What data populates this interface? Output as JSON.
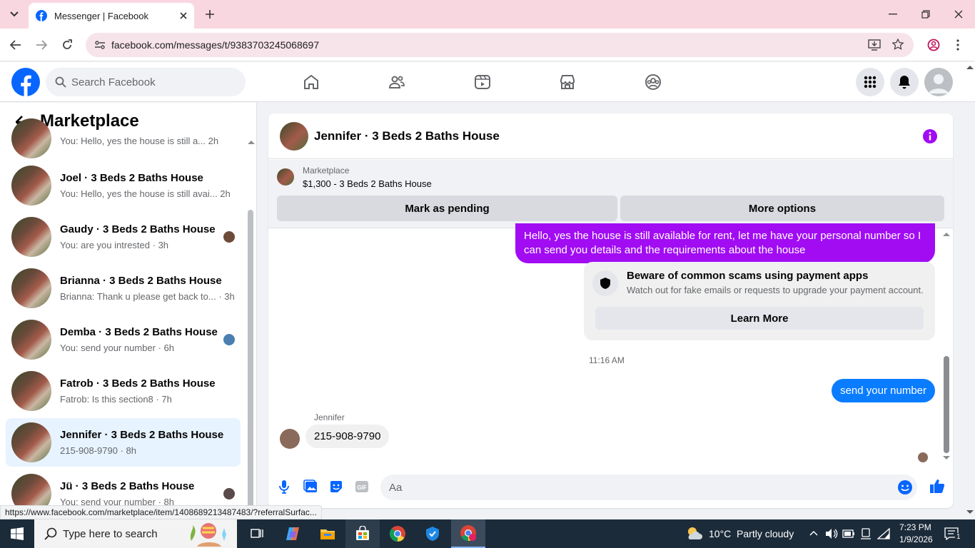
{
  "browser": {
    "tab_title": "Messenger | Facebook",
    "url": "facebook.com/messages/t/9383703245068697"
  },
  "fb": {
    "search_placeholder": "Search Facebook"
  },
  "left": {
    "title": "Marketplace",
    "conversations": [
      {
        "name": "",
        "preview": "You: Hello, yes the house is still a...",
        "time": "2h"
      },
      {
        "name": "Joel · 3 Beds 2 Baths House",
        "preview": "You: Hello, yes the house is still avai...",
        "time": "2h"
      },
      {
        "name": "Gaudy · 3 Beds 2 Baths House",
        "preview": "You: are you intrested",
        "time": "3h"
      },
      {
        "name": "Brianna · 3 Beds 2 Baths House",
        "preview": "Brianna: Thank u please get back to...",
        "time": "3h"
      },
      {
        "name": "Demba · 3 Beds 2 Baths House",
        "preview": "You: send your number",
        "time": "6h"
      },
      {
        "name": "Fatrob · 3 Beds 2 Baths House",
        "preview": "Fatrob: Is this section8",
        "time": "7h"
      },
      {
        "name": "Jennifer · 3 Beds 2 Baths House",
        "preview": "215-908-9790",
        "time": "8h"
      },
      {
        "name": "Jü · 3 Beds 2 Baths House",
        "preview": "You: send your number",
        "time": "8h"
      }
    ]
  },
  "chat": {
    "title": "Jennifer · 3 Beds 2 Baths House",
    "listing_source": "Marketplace",
    "listing": "$1,300 - 3 Beds 2 Baths House",
    "mark_pending": "Mark as pending",
    "more_options": "More options",
    "msg_out_1": "Hello, yes the house is still available for rent, let me have your personal number so I can send you details and the requirements about the house",
    "scam_title": "Beware of common scams using payment apps",
    "scam_body": "Watch out for fake emails or requests to upgrade your payment account.",
    "learn_more": "Learn More",
    "timestamp": "11:16 AM",
    "msg_out_2": "send your number",
    "sender": "Jennifer",
    "msg_in_1": "215-908-9790",
    "composer_placeholder": "Aa"
  },
  "status_url": "https://www.facebook.com/marketplace/item/1408689213487483/?referralSurfac...",
  "taskbar": {
    "search_placeholder": "Type here to search",
    "weather": "10°C  Partly cloudy",
    "time": "7:23 PM",
    "date": "1/9/2026",
    "notif_count": "1"
  },
  "colors": {
    "fb_blue": "#0866ff",
    "accent_purple": "#a10cf3",
    "chrome_pink": "#f9d7e1"
  }
}
